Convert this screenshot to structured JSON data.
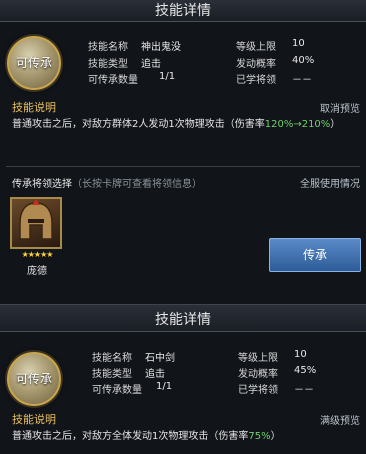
{
  "panel1": {
    "title": "技能详情",
    "medal": "可传承",
    "stats": {
      "name_label": "技能名称",
      "name_value": "神出鬼没",
      "type_label": "技能类型",
      "type_value": "追击",
      "count_label": "可传承数量",
      "count_value": "1/1",
      "level_label": "等级上限",
      "level_value": "10",
      "prob_label": "发动概率",
      "prob_value": "40%",
      "learned_label": "已学将领",
      "learned_value": "－－"
    },
    "desc": {
      "heading": "技能说明",
      "link": "取消预览",
      "text": "普通攻击之后，对敌方群体2人发动1次物理攻击（伤害率",
      "highlight": "120%→210%",
      "suffix": "）"
    },
    "heir": {
      "label": "传承将领选择",
      "hint": "（长按卡牌可查看将领信息）",
      "link": "全服使用情况",
      "stars": "★★★★★",
      "name": "庞德",
      "button": "传承"
    }
  },
  "panel2": {
    "title": "技能详情",
    "medal": "可传承",
    "stats": {
      "name_label": "技能名称",
      "name_value": "石中剑",
      "type_label": "技能类型",
      "type_value": "追击",
      "count_label": "可传承数量",
      "count_value": "1/1",
      "level_label": "等级上限",
      "level_value": "10",
      "prob_label": "发动概率",
      "prob_value": "45%",
      "learned_label": "已学将领",
      "learned_value": "－－"
    },
    "desc": {
      "heading": "技能说明",
      "link": "满级预览",
      "text": "普通攻击之后，对敌方全体发动1次物理攻击（伤害率",
      "highlight": "75%",
      "suffix": "）"
    }
  }
}
